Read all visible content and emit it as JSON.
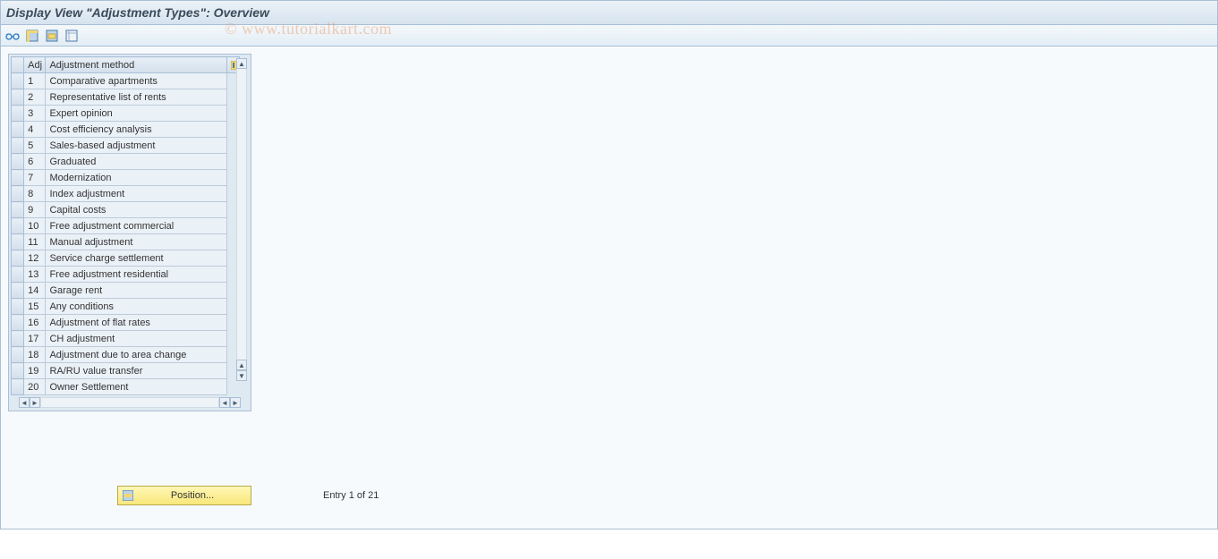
{
  "title": "Display View \"Adjustment Types\": Overview",
  "watermark": "© www.tutorialkart.com",
  "toolbar": {
    "btn1": "details-icon",
    "btn2": "select-all-icon",
    "btn3": "select-block-icon",
    "btn4": "deselect-all-icon"
  },
  "table": {
    "headers": {
      "sel": "",
      "adj": "Adj",
      "method": "Adjustment method",
      "cfg": ""
    },
    "rows": [
      {
        "adj": "1",
        "method": "Comparative apartments"
      },
      {
        "adj": "2",
        "method": "Representative list of rents"
      },
      {
        "adj": "3",
        "method": "Expert opinion"
      },
      {
        "adj": "4",
        "method": "Cost efficiency analysis"
      },
      {
        "adj": "5",
        "method": "Sales-based adjustment"
      },
      {
        "adj": "6",
        "method": "Graduated"
      },
      {
        "adj": "7",
        "method": "Modernization"
      },
      {
        "adj": "8",
        "method": "Index adjustment"
      },
      {
        "adj": "9",
        "method": "Capital costs"
      },
      {
        "adj": "10",
        "method": "Free adjustment commercial"
      },
      {
        "adj": "11",
        "method": "Manual adjustment"
      },
      {
        "adj": "12",
        "method": "Service charge settlement"
      },
      {
        "adj": "13",
        "method": "Free adjustment residential"
      },
      {
        "adj": "14",
        "method": "Garage rent"
      },
      {
        "adj": "15",
        "method": "Any conditions"
      },
      {
        "adj": "16",
        "method": "Adjustment of flat rates"
      },
      {
        "adj": "17",
        "method": "CH adjustment"
      },
      {
        "adj": "18",
        "method": "Adjustment due to area change"
      },
      {
        "adj": "19",
        "method": "RA/RU value transfer"
      },
      {
        "adj": "20",
        "method": "Owner Settlement"
      }
    ]
  },
  "footer": {
    "position_label": "Position...",
    "entry_text": "Entry 1 of 21"
  }
}
